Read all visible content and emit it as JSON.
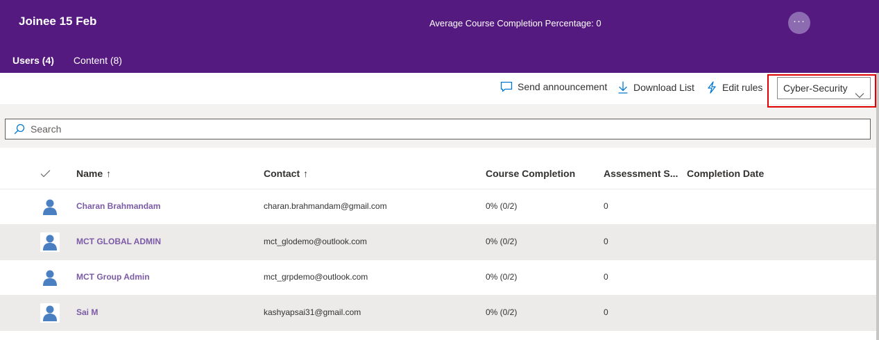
{
  "header": {
    "title": "Joinee 15 Feb",
    "avg_completion": "Average Course Completion Percentage: 0",
    "more_label": "···",
    "tabs": [
      {
        "label": "Users (4)",
        "active": true
      },
      {
        "label": "Content (8)",
        "active": false
      }
    ]
  },
  "toolbar": {
    "send_announcement": "Send announcement",
    "download_list": "Download List",
    "edit_rules": "Edit rules",
    "dropdown_value": "Cyber-Security"
  },
  "search": {
    "placeholder": "Search",
    "value": ""
  },
  "table": {
    "columns": {
      "name": "Name",
      "contact": "Contact",
      "course_completion": "Course Completion",
      "assessment": "Assessment S...",
      "completion_date": "Completion Date"
    },
    "sort_arrow": "↑",
    "rows": [
      {
        "name": "Charan Brahmandam",
        "contact": "charan.brahmandam@gmail.com",
        "course": "0% (0/2)",
        "assessment": "0",
        "date": ""
      },
      {
        "name": "MCT GLOBAL ADMIN",
        "contact": "mct_glodemo@outlook.com",
        "course": "0% (0/2)",
        "assessment": "0",
        "date": ""
      },
      {
        "name": "MCT Group Admin",
        "contact": "mct_grpdemo@outlook.com",
        "course": "0% (0/2)",
        "assessment": "0",
        "date": ""
      },
      {
        "name": "Sai M",
        "contact": "kashyapsai31@gmail.com",
        "course": "0% (0/2)",
        "assessment": "0",
        "date": ""
      }
    ]
  },
  "colors": {
    "header_bg": "#551a80",
    "accent_link": "#7b5aa6",
    "icon_blue": "#0078d4",
    "highlight_outline": "#e00000"
  },
  "icons": {
    "more": "ellipsis-icon",
    "send_announcement": "chat-bubble-icon",
    "download_list": "download-arrow-icon",
    "edit_rules": "lightning-bolt-icon",
    "dropdown": "chevron-down-icon",
    "search": "search-icon",
    "select_all": "checkmark-icon",
    "avatar": "person-icon"
  }
}
